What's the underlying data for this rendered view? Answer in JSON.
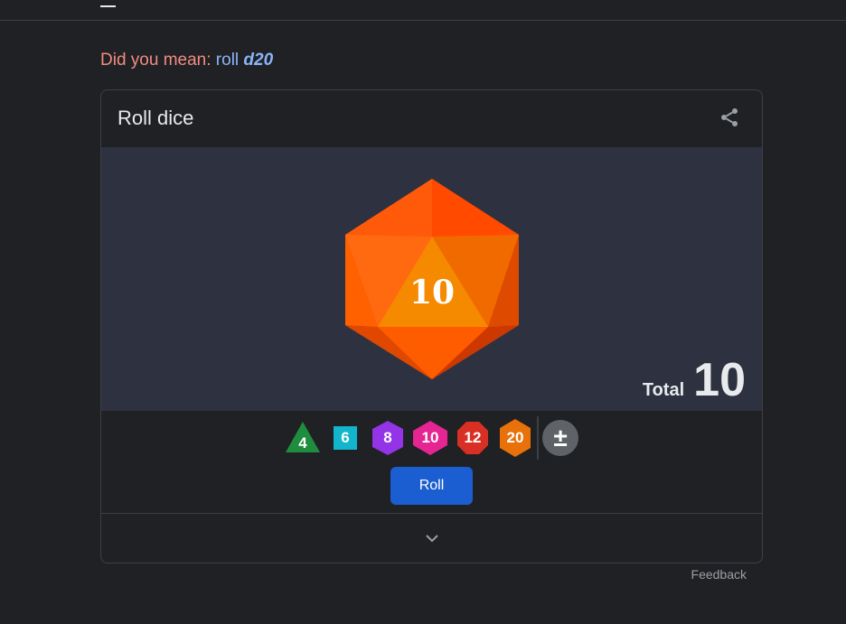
{
  "did_you_mean": {
    "prefix": "Did you mean:",
    "link_plain": "roll",
    "link_bold": "d20"
  },
  "card": {
    "title": "Roll dice",
    "share_icon": "share-icon",
    "die_face_value": "10",
    "total_label": "Total",
    "total_value": "10",
    "dice": [
      {
        "label": "4",
        "shape": "triangle",
        "color": "#1e8e3e"
      },
      {
        "label": "6",
        "shape": "square",
        "color": "#12b5cb"
      },
      {
        "label": "8",
        "shape": "hexagon",
        "color": "#9334e6"
      },
      {
        "label": "10",
        "shape": "hexagon",
        "color": "#e52592"
      },
      {
        "label": "12",
        "shape": "octagon",
        "color": "#d93025"
      },
      {
        "label": "20",
        "shape": "hexagon",
        "color": "#e8710a"
      }
    ],
    "plus_minus_label": "±",
    "roll_label": "Roll",
    "expand_icon": "chevron-down-icon"
  },
  "feedback_label": "Feedback",
  "colors": {
    "background": "#202124",
    "stage": "#2e3240",
    "accent_button": "#1a5ed1",
    "die_orange": "#ff6d00"
  }
}
